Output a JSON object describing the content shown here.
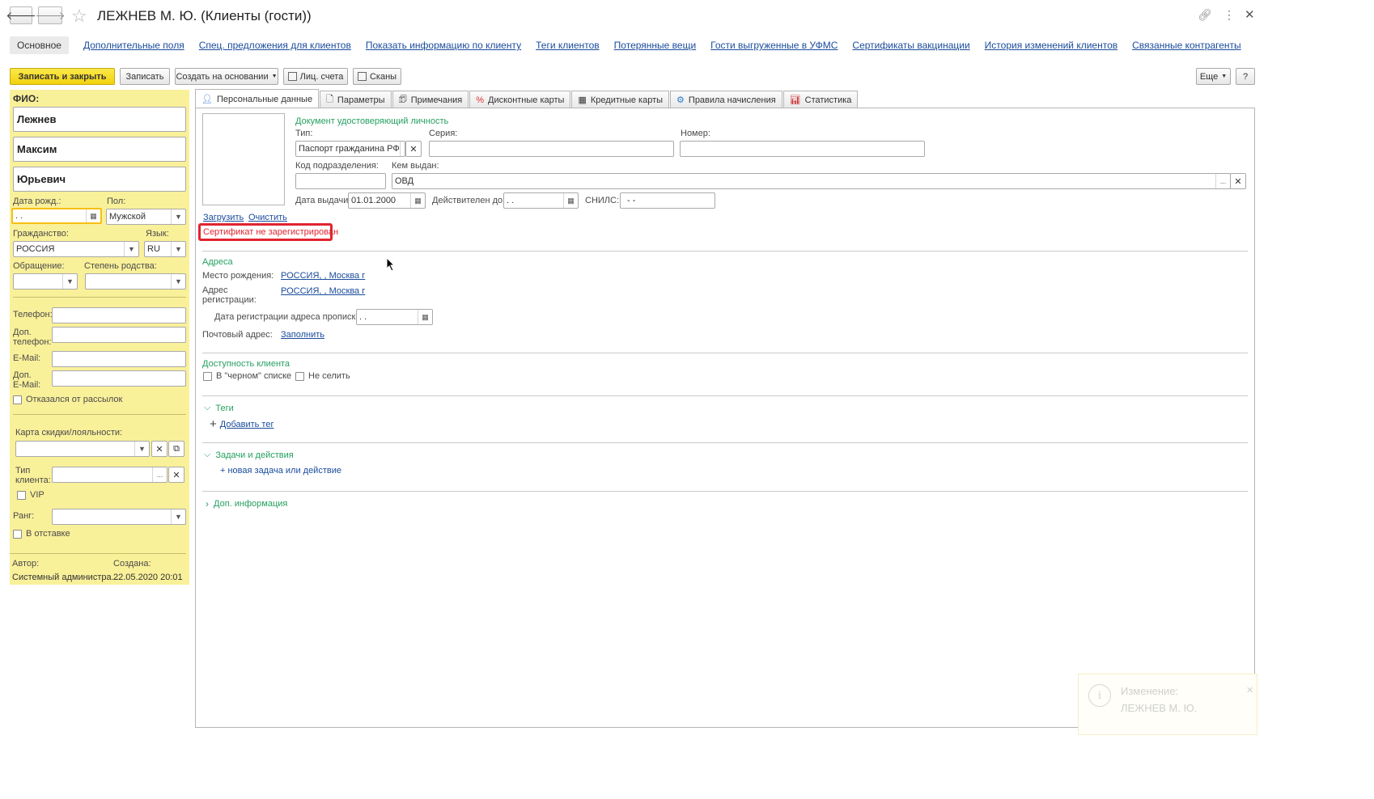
{
  "window": {
    "title": "ЛЕЖНЕВ М. Ю. (Клиенты (гости))"
  },
  "form_tabs": [
    "Основное",
    "Дополнительные поля",
    "Спец. предложения для клиентов",
    "Показать информацию по клиенту",
    "Теги клиентов",
    "Потерянные вещи",
    "Гости выгруженные в УФМС",
    "Сертификаты вакцинации",
    "История изменений клиентов",
    "Связанные контрагенты"
  ],
  "toolbar": {
    "save_close": "Записать и закрыть",
    "save": "Записать",
    "create_based": "Создать на основании",
    "accounts": "Лиц. счета",
    "scans": "Сканы",
    "more": "Еще",
    "help": "?"
  },
  "left": {
    "fio_label": "ФИО:",
    "last_name": "Лежнев",
    "first_name": "Максим",
    "middle_name": "Юрьевич",
    "dob_label": "Дата рожд.:",
    "dob_value": ". .",
    "gender_label": "Пол:",
    "gender_value": "Мужской",
    "citizenship_label": "Гражданство:",
    "citizenship_value": "РОССИЯ",
    "lang_label": "Язык:",
    "lang_value": "RU",
    "address_label": "Обращение:",
    "relation_label": "Степень родства:",
    "phone_label": "Телефон:",
    "phone2_label_1": "Доп.",
    "phone2_label_2": "телефон:",
    "email_label": "E-Mail:",
    "email2_label_1": "Доп.",
    "email2_label_2": "E-Mail:",
    "unsubscribed_label": "Отказался от рассылок",
    "card_label": "Карта скидки/лояльности:",
    "client_type_label_1": "Тип",
    "client_type_label_2": "клиента:",
    "vip_label": "VIP",
    "rank_label": "Ранг:",
    "retired_label": "В отставке",
    "author_label": "Автор:",
    "author_value": "Системный администра...",
    "created_label": "Создана:",
    "created_value": "22.05.2020 20:01"
  },
  "tabs": [
    "Персональные данные",
    "Параметры",
    "Примечания",
    "Дисконтные карты",
    "Кредитные карты",
    "Правила начисления",
    "Статистика"
  ],
  "personal": {
    "load_link": "Загрузить",
    "clear_link": "Очистить",
    "doc_group": "Документ удостоверяющий личность",
    "type_label": "Тип:",
    "type_value": "Паспорт гражданина РФ",
    "series_label": "Серия:",
    "number_label": "Номер:",
    "division_label": "Код подразделения:",
    "issued_by_label": "Кем выдан:",
    "issued_by_value": "ОВД",
    "issue_date_label": "Дата выдачи:",
    "issue_date_value": "01.01.2000",
    "valid_until_label": "Действителен до:",
    "valid_until_value": ". .",
    "snils_label": "СНИЛС:",
    "snils_value": "-   -",
    "cert_warning": "Сертификат не зарегистрирован",
    "addresses_group": "Адреса",
    "birthplace_label": "Место рождения:",
    "birthplace_value": "РОССИЯ, , Москва г",
    "reg_addr_label_1": "Адрес",
    "reg_addr_label_2": "регистрации:",
    "reg_addr_value": "РОССИЯ, , Москва г",
    "reg_date_label": "Дата регистрации адреса прописки:",
    "reg_date_value": ". .",
    "mail_label": "Почтовый адрес:",
    "mail_link": "Заполнить",
    "availability_group": "Доступность клиента",
    "blacklist_label": "В \"черном\" списке",
    "no_checkin_label": "Не селить",
    "tags_group": "Теги",
    "add_tag": "Добавить тег",
    "tasks_group": "Задачи и действия",
    "new_task": "+ новая задача или действие",
    "extra_group": "Доп. информация"
  },
  "notification": {
    "title": "Изменение:",
    "text": "ЛЕЖНЕВ М. Ю."
  },
  "colors": {
    "left_panel": "#f9f09a",
    "accent_yellow": "#f5d916",
    "group_green": "#25a061",
    "link_blue": "#1a4b9c",
    "warning_red": "#e0242f"
  }
}
